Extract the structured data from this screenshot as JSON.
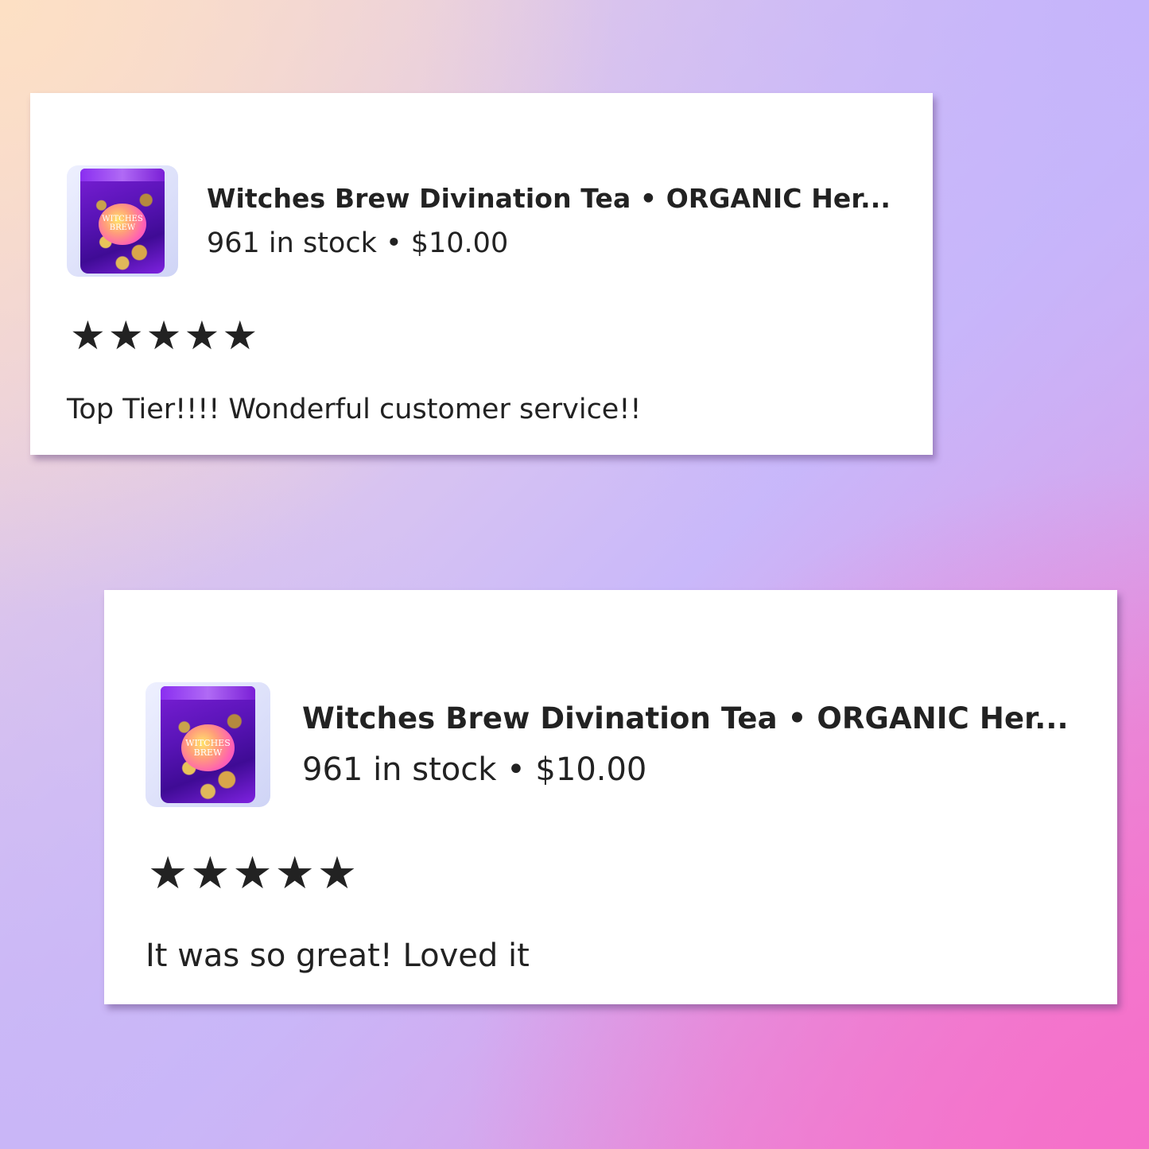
{
  "colors": {
    "card_background": "#ffffff",
    "text": "#222222",
    "pouch_purple": "#6b1bc9",
    "background_gradient": [
      "#fde0c4",
      "#c9b8fa",
      "#f56fc9"
    ]
  },
  "reviews": [
    {
      "product_title": "Witches Brew Divination Tea • ORGANIC Her...",
      "stock_price": "961 in stock • $10.00",
      "rating": 5,
      "stars": [
        "★",
        "★",
        "★",
        "★",
        "★"
      ],
      "text": "Top Tier!!!! Wonderful customer service!!",
      "thumbnail": {
        "icon": "tea-pouch-image",
        "label_line1": "WITCHES",
        "label_line2": "BREW"
      }
    },
    {
      "product_title": "Witches Brew Divination Tea • ORGANIC Her...",
      "stock_price": "961 in stock • $10.00",
      "rating": 5,
      "stars": [
        "★",
        "★",
        "★",
        "★",
        "★"
      ],
      "text": "It was so great! Loved it",
      "thumbnail": {
        "icon": "tea-pouch-image",
        "label_line1": "WITCHES",
        "label_line2": "BREW"
      }
    }
  ]
}
